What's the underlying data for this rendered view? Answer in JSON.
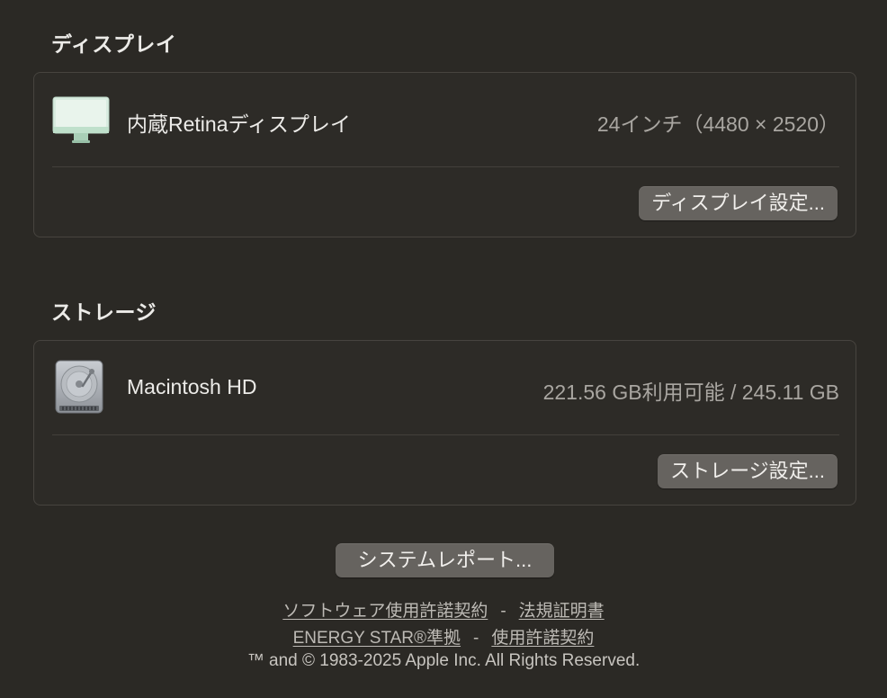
{
  "display": {
    "section_title": "ディスプレイ",
    "item_name": "内蔵Retinaディスプレイ",
    "item_value": "24インチ（4480 × 2520）",
    "button_label": "ディスプレイ設定..."
  },
  "storage": {
    "section_title": "ストレージ",
    "item_name": "Macintosh HD",
    "item_value": "221.56 GB利用可能 / 245.11 GB",
    "button_label": "ストレージ設定..."
  },
  "system_report": {
    "button_label": "システムレポート..."
  },
  "footer": {
    "software_license": "ソフトウェア使用許諾契約",
    "separator": "-",
    "regulatory": "法規証明書",
    "energy_star": "ENERGY STAR®準拠",
    "license": "使用許諾契約",
    "copyright": "™ and © 1983-2025 Apple Inc. All Rights Reserved."
  },
  "icons": {
    "display": "imac-display-icon",
    "storage": "hard-drive-icon"
  },
  "colors": {
    "background": "#2b2925",
    "panel_border": "#47443f",
    "button": "#66635f",
    "display_icon": "#cfe6d8"
  }
}
